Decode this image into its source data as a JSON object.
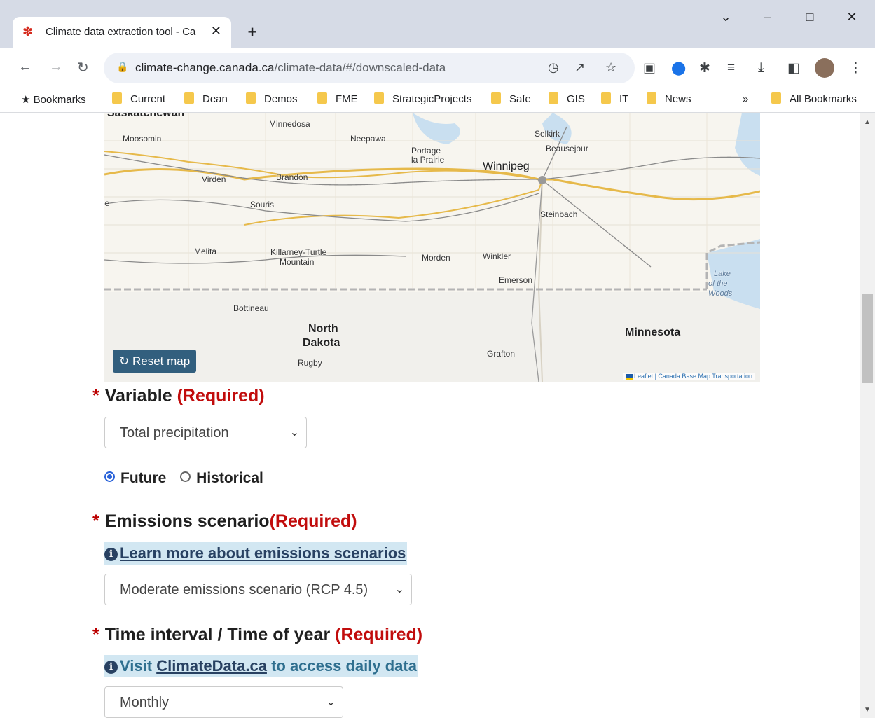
{
  "browser": {
    "tab_title": "Climate data extraction tool - Ca",
    "url_domain": "climate-change.canada.ca",
    "url_path": "/climate-data/#/downscaled-data",
    "bookmarks": [
      "Bookmarks",
      "Current",
      "Dean",
      "Demos",
      "FME",
      "StrategicProjects",
      "Safe",
      "GIS",
      "IT",
      "News"
    ],
    "all_bookmarks": "All Bookmarks",
    "overflow": "»"
  },
  "map": {
    "labels": {
      "saskatchewan": "Saskatchewan",
      "moosomin": "Moosomin",
      "minnedosa": "Minnedosa",
      "neepawa": "Neepawa",
      "portage": "Portage",
      "la_prairie": "la Prairie",
      "selkirk": "Selkirk",
      "beausejour": "Beausejour",
      "winnipeg": "Winnipeg",
      "virden": "Virden",
      "brandon": "Brandon",
      "souris": "Souris",
      "steinbach": "Steinbach",
      "melita": "Melita",
      "killarney": "Killarney-Turtle",
      "mountain": "Mountain",
      "morden": "Morden",
      "winkler": "Winkler",
      "emerson": "Emerson",
      "lake1": "Lake",
      "lake2": "of the",
      "lake3": "Woods",
      "bottineau": "Bottineau",
      "north": "North",
      "dakota": "Dakota",
      "minnesota": "Minnesota",
      "grafton": "Grafton",
      "rugby": "Rugby",
      "edge_le": "le"
    },
    "reset_label": "Reset map",
    "attribution": "Leaflet | Canada Base Map Transportation"
  },
  "form": {
    "required_star": "*",
    "variable": {
      "label": "Variable",
      "required": "(Required)",
      "value": "Total precipitation"
    },
    "period": {
      "future": "Future",
      "historical": "Historical",
      "selected": "Future"
    },
    "emissions": {
      "label": "Emissions scenario",
      "required": "(Required)",
      "info_link": "Learn more about emissions scenarios",
      "value": "Moderate emissions scenario (RCP 4.5)"
    },
    "time": {
      "label": "Time interval / Time of year",
      "required": "(Required)",
      "info_prefix": "Visit",
      "info_link": "ClimateData.ca",
      "info_suffix": "to access daily data",
      "value": "Monthly"
    }
  },
  "colors": {
    "required": "#c10c0c",
    "button": "#325f7e",
    "info_bg": "#d2e7f2",
    "link": "#284162"
  }
}
